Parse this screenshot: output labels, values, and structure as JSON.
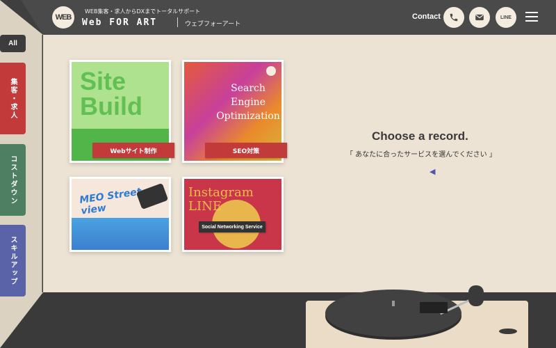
{
  "header": {
    "logo_text": "WEB",
    "tagline": "WEB集客・求人からDXまでトータルサポート",
    "brand": "Web FOR ART",
    "brand_kana": "ウェブフォーアート",
    "contact_label": "Contact",
    "line_label": "LINE"
  },
  "sidebar": {
    "items": [
      {
        "label": "All",
        "color": "#3c3c3c"
      },
      {
        "label": "集客・求人",
        "color": "#c23a3a"
      },
      {
        "label": "コストダウン",
        "color": "#4e7f63"
      },
      {
        "label": "スキルアップ",
        "color": "#5b63a8"
      }
    ]
  },
  "records": [
    {
      "art_text": "Site Build",
      "label": "Webサイト制作",
      "label_color": "#c23a3a"
    },
    {
      "art_text": "Search Engine Optimization",
      "label": "SEO対策",
      "label_color": "#c23a3a"
    },
    {
      "art_text": "MEO Street view"
    },
    {
      "art_text": "Instagram LINE",
      "label": "Social Networking Service",
      "label_color": "#333333"
    }
  ],
  "prompt": {
    "title": "Choose a record.",
    "subtitle": "「 あなたに合ったサービスを選んでください 」"
  },
  "icons": [
    "phone-icon",
    "mail-icon",
    "line-icon",
    "menu-icon",
    "pointer-arrow-icon"
  ]
}
